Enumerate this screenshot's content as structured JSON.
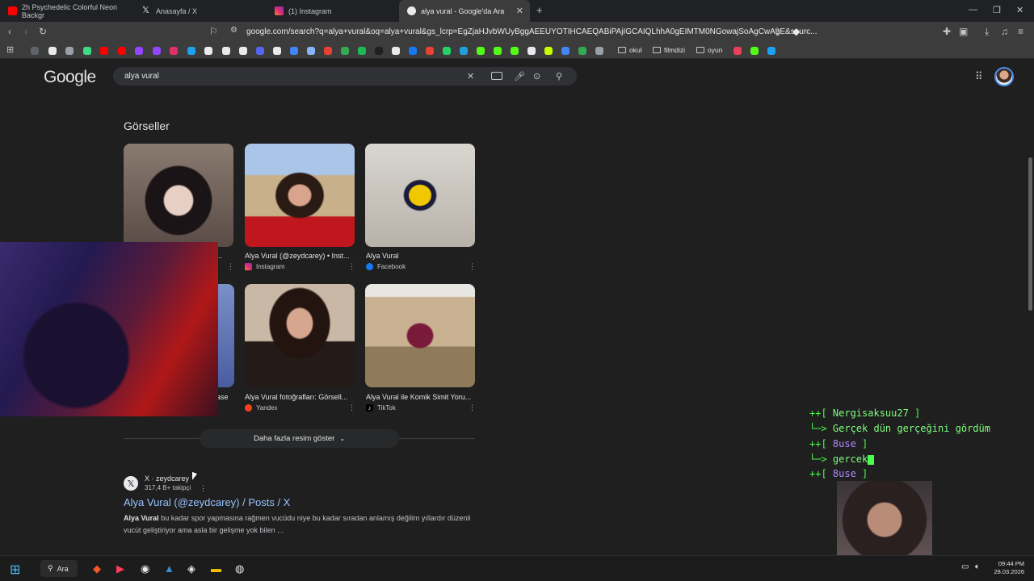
{
  "tabs": [
    {
      "title": "2h Psychedelic Colorful Neon Backgr",
      "favicon": "youtube-icon",
      "color": "#ff0000"
    },
    {
      "title": "Anasayfa / X",
      "favicon": "x-icon",
      "color": "#e8eaed"
    },
    {
      "title": "(1) Instagram",
      "favicon": "instagram-icon",
      "color": "#e1306c"
    },
    {
      "title": "alya vural - Google'da Ara",
      "favicon": "google-icon",
      "color": "#e8eaed"
    }
  ],
  "address_bar": {
    "url": "google.com/search?q=alya+vural&oq=alya+vural&gs_lcrp=EgZjaHJvbWUyBggAEEUYOTIHCAEQABiPAjIGCAIQLhhA0gEIMTM0NGowajSoAgCwAgE&sourc..."
  },
  "bookmarks": {
    "folders": [
      "okul",
      "filmdizi",
      "oyun"
    ],
    "icon_colors": [
      "#5f6368",
      "#e8eaed",
      "#9aa0a6",
      "#3ddc84",
      "#ff0000",
      "#ff0000",
      "#9146ff",
      "#9146ff",
      "#e1306c",
      "#1da1f2",
      "#e8eaed",
      "#e8eaed",
      "#e8eaed",
      "#5865f2",
      "#e8eaed",
      "#4285f4",
      "#8ab4f8",
      "#e94235",
      "#34a853",
      "#1db954",
      "#1f1f1f",
      "#e8eaed",
      "#1877f2",
      "#e94235",
      "#25d366",
      "#229ed9",
      "#53fc18",
      "#53fc18",
      "#53fc18",
      "#e8eaed",
      "#c6ff00",
      "#4285f4",
      "#34a853",
      "#9aa0a6"
    ],
    "icon_colors_after": [
      "#e94057",
      "#53fc18",
      "#1da1f2"
    ]
  },
  "google": {
    "logo": "Google",
    "query": "alya vural"
  },
  "images_section": {
    "title": "Görseller",
    "cards": [
      {
        "caption": "Alya Vural (@zeydcarey) • Inst...",
        "source": "Instagram",
        "source_color": "#e1306c"
      },
      {
        "caption": "Alya Vural",
        "source": "Facebook",
        "source_color": "#1877f2"
      },
      {
        "caption": "Alya Vural fotoğrafları: Görsell...",
        "source": "Yandex",
        "source_color": "#fc3f1d"
      },
      {
        "caption": "Alya Vural ile Komik Simit Yoru...",
        "source": "TikTok",
        "source_color": "#e8eaed"
      }
    ],
    "partial_caption_1": "al ...",
    "partial_caption_2": "ase",
    "more_button": "Daha fazla resim göster"
  },
  "result": {
    "site": "X · zeydcarey",
    "followers": "317,4 B+ takipçi",
    "title": "Alya Vural (@zeydcarey) / Posts / X",
    "desc_bold": "Alya Vural",
    "desc_rest": " bu kadar spor yapmasına rağmen vucüdu niye bu kadar sıradan anlamış değilim yıllardır düzenli vucüt geliştiriyor ama asla bir gelişme yok bilen ..."
  },
  "chat": [
    {
      "prefix": "++[",
      "text": "Nergisaksuu27",
      "suffix": "]",
      "color": "#7dff7d"
    },
    {
      "prefix": "└─>",
      "text": "Gerçek dün gerçeğini gördüm",
      "suffix": "",
      "color": "#7dff7d"
    },
    {
      "prefix": "++[",
      "text": "8use",
      "suffix": "]",
      "color": "#b388ff"
    },
    {
      "prefix": "└─>",
      "text": "gercek",
      "suffix": "",
      "color": "#7dff7d"
    },
    {
      "prefix": "++[",
      "text": "8use",
      "suffix": "]",
      "color": "#b388ff"
    },
    {
      "prefix": "└─>",
      "text": "",
      "suffix": "",
      "color": "#7dff7d"
    }
  ],
  "taskbar": {
    "search_label": "Ara",
    "time": "09:44 PM",
    "date": "28.03.2026"
  }
}
